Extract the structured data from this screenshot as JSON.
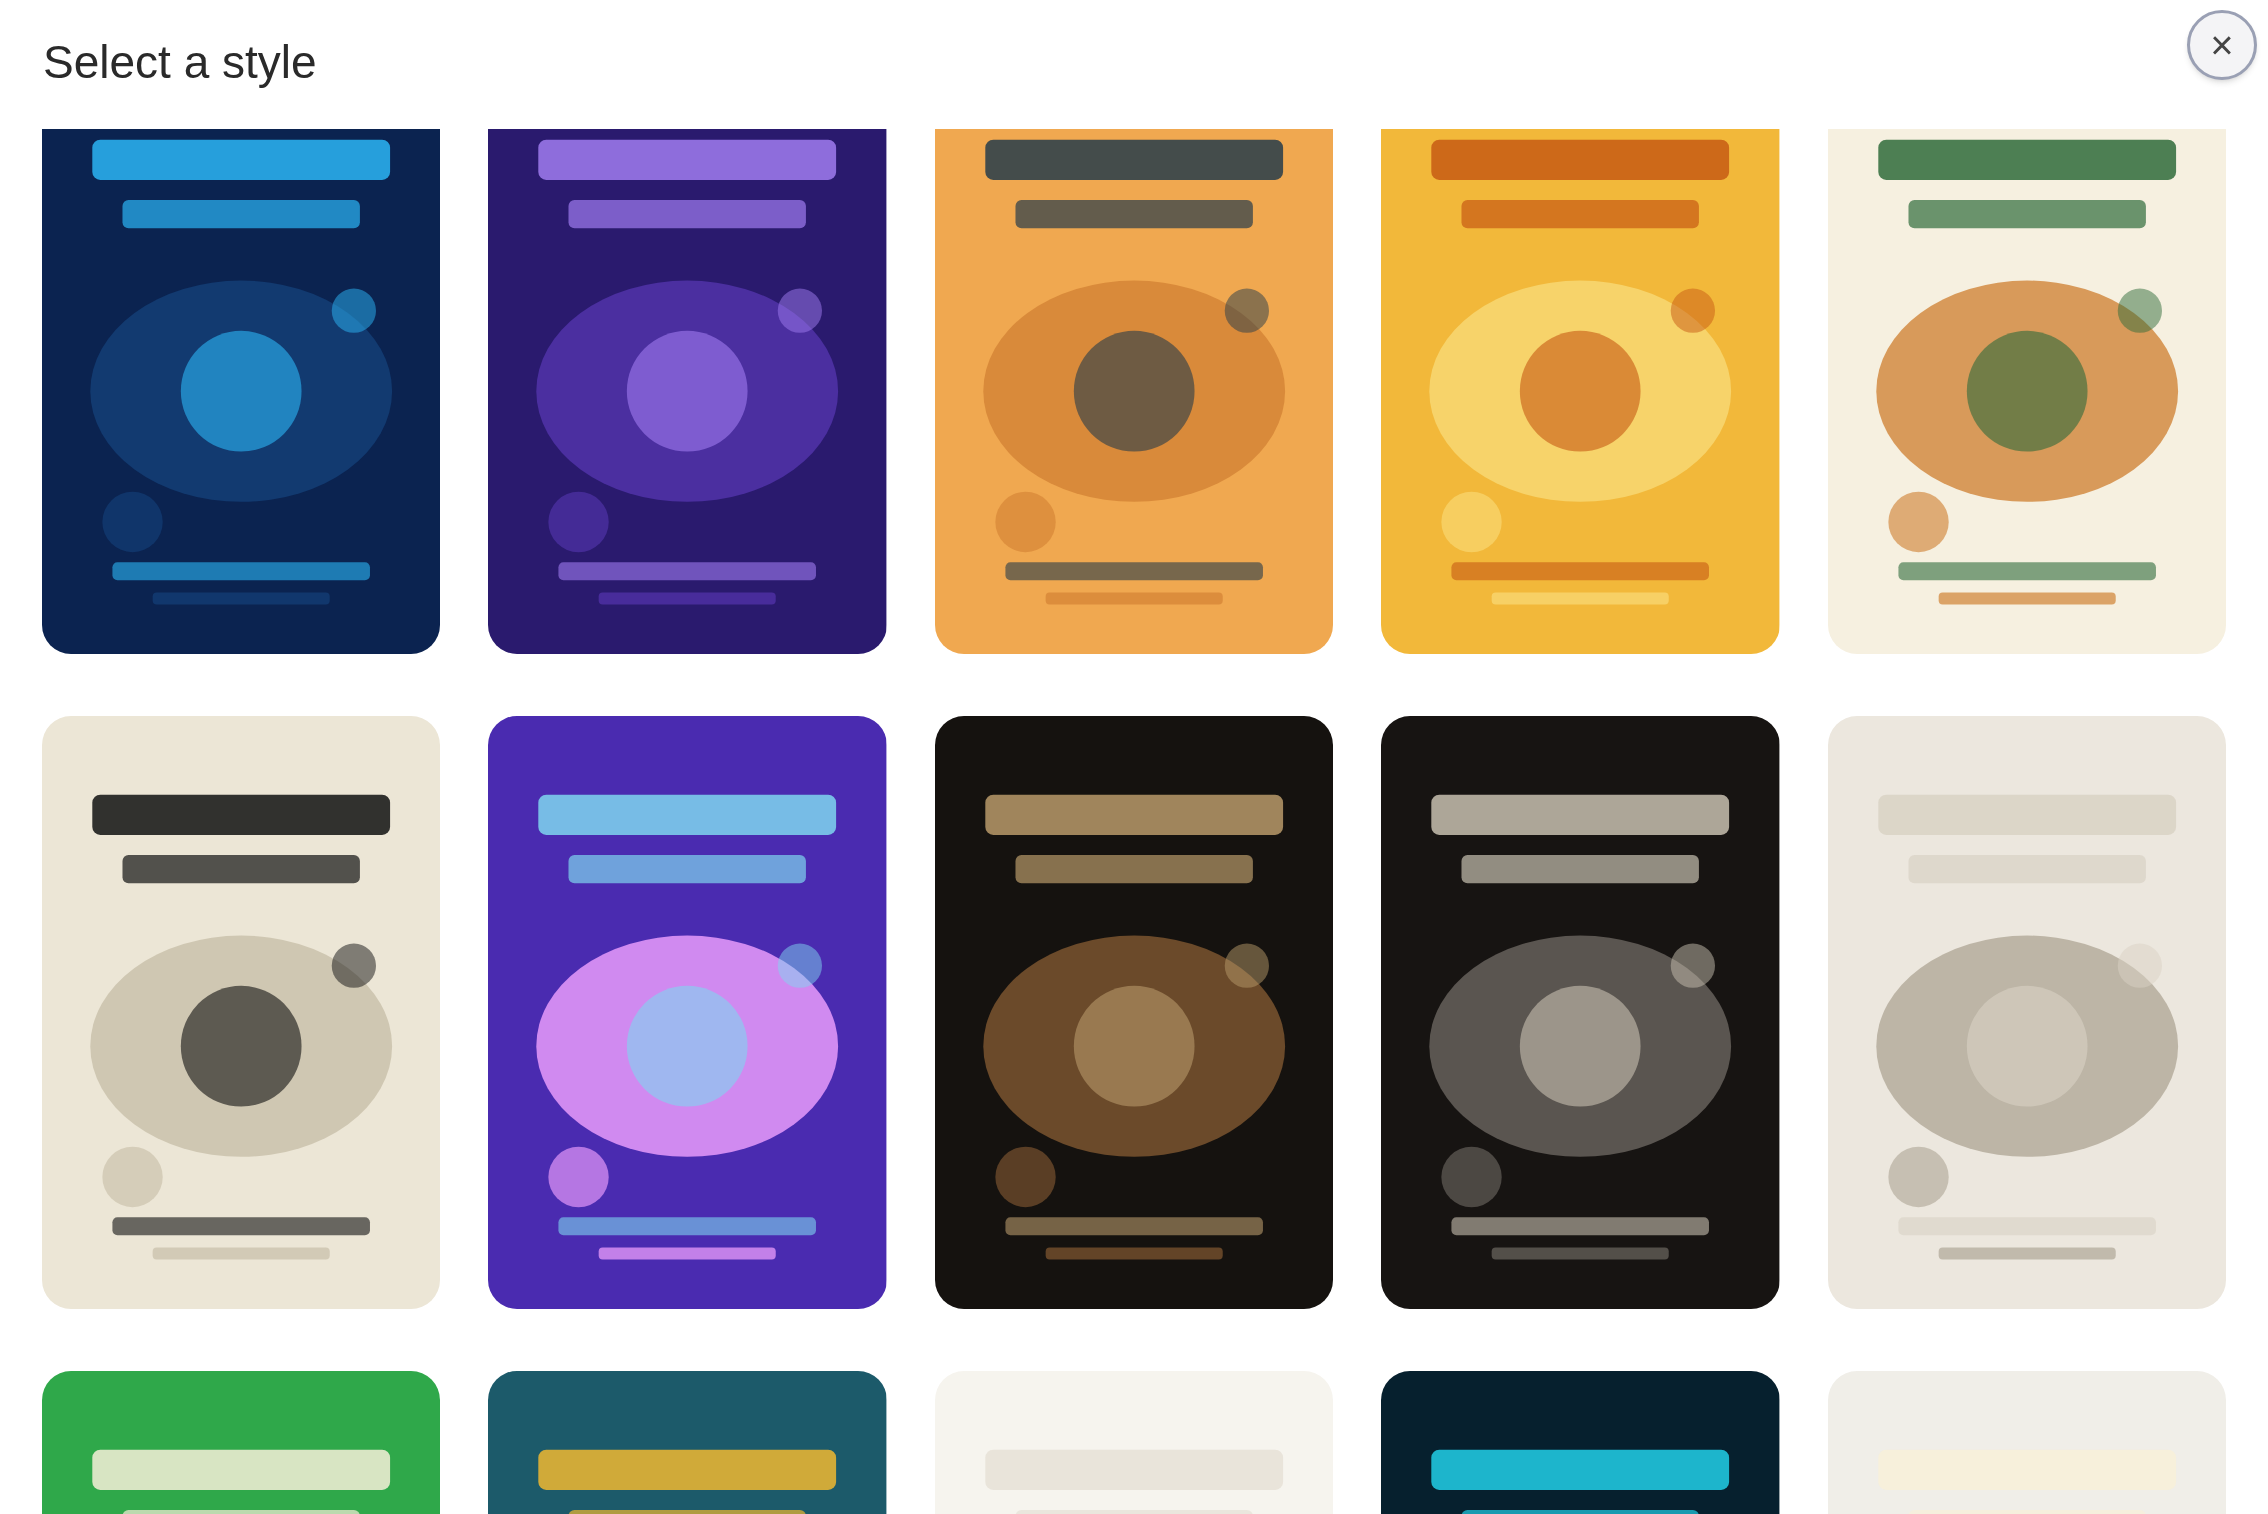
{
  "dialog": {
    "title": "Select a style",
    "close_button": {
      "label": "×"
    }
  }
}
